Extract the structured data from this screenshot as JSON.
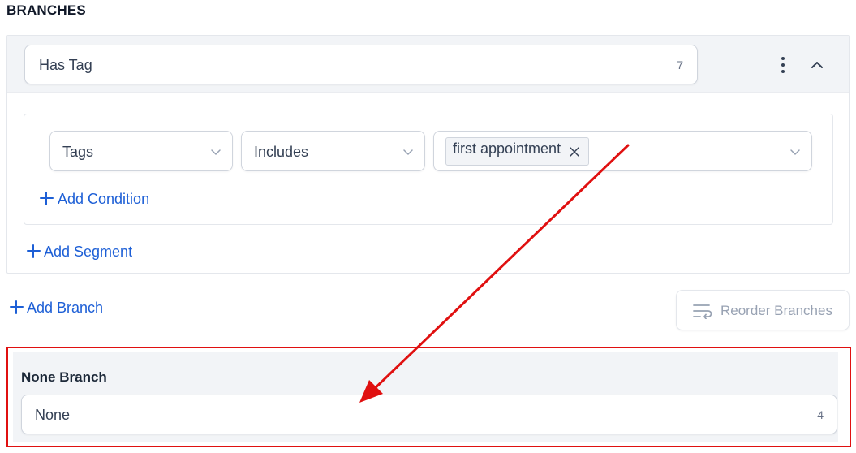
{
  "section_title": "BRANCHES",
  "branch": {
    "name": "Has Tag",
    "count": "7",
    "condition": {
      "field": "Tags",
      "operator": "Includes",
      "values": [
        "first appointment"
      ]
    },
    "add_condition_label": "Add Condition",
    "add_segment_label": "Add Segment"
  },
  "add_branch_label": "Add Branch",
  "reorder_label": "Reorder Branches",
  "none_branch": {
    "title": "None Branch",
    "name": "None",
    "count": "4"
  },
  "colors": {
    "annotation": "#e01010",
    "link": "#1d5fd6"
  },
  "icons": [
    "kebab-menu-icon",
    "chevron-up-icon",
    "chevron-down-icon",
    "close-icon",
    "plus-icon",
    "reorder-icon"
  ]
}
